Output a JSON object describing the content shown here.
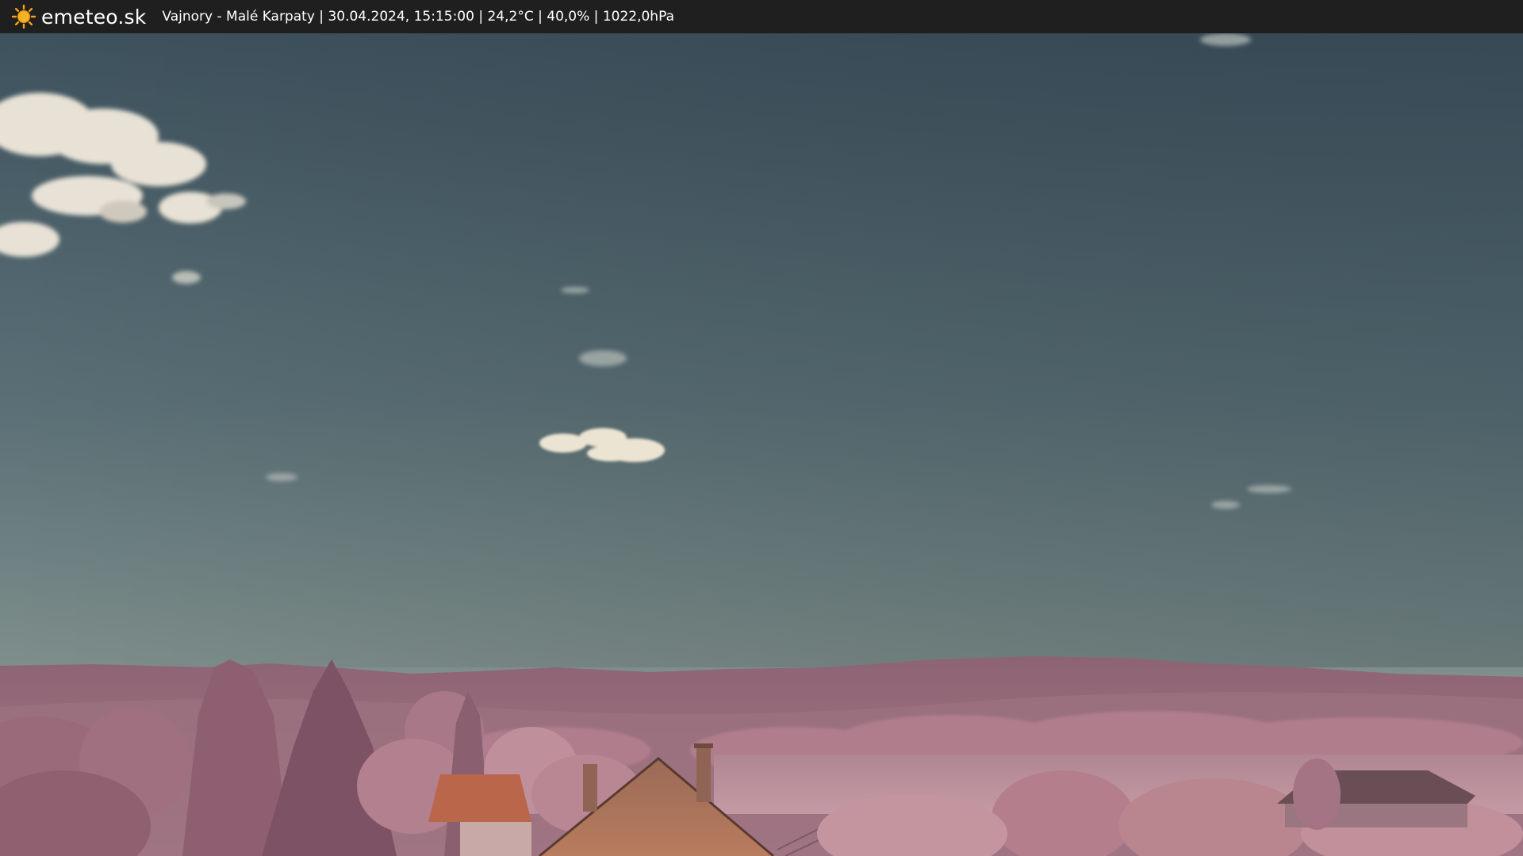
{
  "header": {
    "logo_text": "emeteo.sk",
    "logo_icon": "sun-icon",
    "location": "Vajnory - Malé Karpaty",
    "datetime": "30.04.2024, 15:15:00",
    "temperature": "24,2°C",
    "humidity": "40,0%",
    "pressure": "1022,0hPa",
    "separator": " | "
  },
  "colors": {
    "topbar": "#1f1f1f",
    "sun": "#f2a21b",
    "sky_top": "#3f5460",
    "sky_bottom": "#8f9a90",
    "foliage": "#b47a8c",
    "roof": "#b86a48"
  }
}
